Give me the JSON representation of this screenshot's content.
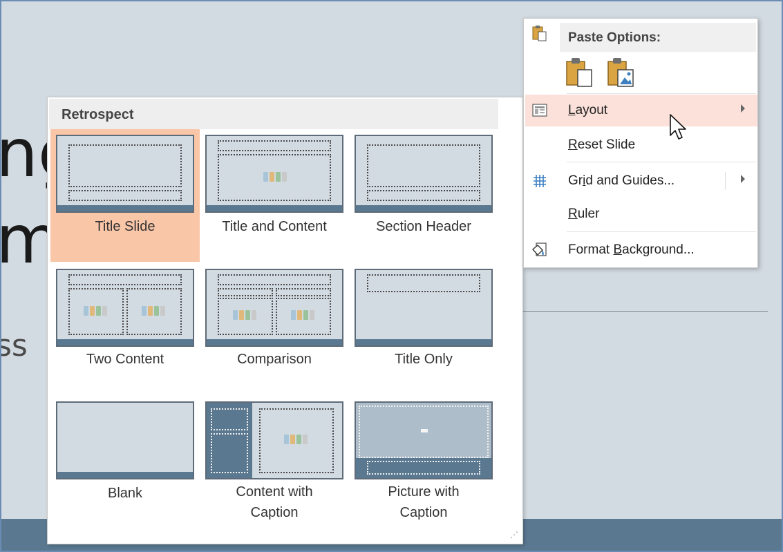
{
  "slide": {
    "text_line1": "ng",
    "text_line2": "m",
    "text_line3": "ss"
  },
  "gallery": {
    "section_title": "Retrospect",
    "layouts": [
      {
        "label": "Title Slide",
        "selected": true
      },
      {
        "label": "Title and Content",
        "selected": false
      },
      {
        "label": "Section Header",
        "selected": false
      },
      {
        "label": "Two Content",
        "selected": false
      },
      {
        "label": "Comparison",
        "selected": false
      },
      {
        "label": "Title Only",
        "selected": false
      },
      {
        "label": "Blank",
        "selected": false
      },
      {
        "label_line1": "Content with",
        "label_line2": "Caption",
        "selected": false
      },
      {
        "label_line1": "Picture with",
        "label_line2": "Caption",
        "selected": false
      }
    ],
    "resize_grip": "⋰"
  },
  "context_menu": {
    "paste_options_title": "Paste Options:",
    "items": [
      {
        "label": "Layout",
        "underline": "L",
        "rest": "ayout",
        "has_submenu": true,
        "hovered": true,
        "icon": "layout-icon"
      },
      {
        "label": "Reset Slide",
        "underline": "R",
        "rest": "eset Slide",
        "has_submenu": false,
        "icon": ""
      },
      {
        "label": "Grid and Guides...",
        "pre": "Gr",
        "underline": "i",
        "rest": "d and Guides...",
        "has_submenu": true,
        "icon": "grid-icon"
      },
      {
        "label": "Ruler",
        "underline": "R",
        "rest": "uler",
        "has_submenu": false,
        "icon": ""
      },
      {
        "label": "Format Background...",
        "pre": "Format ",
        "underline": "B",
        "rest": "ackground...",
        "has_submenu": false,
        "icon": "format-background-icon"
      }
    ]
  },
  "colors": {
    "slide_bg": "#d3dbe2",
    "slide_band": "#5a7890",
    "selected_tile": "#f9c6a8",
    "menu_hover": "#fbe1d9"
  }
}
